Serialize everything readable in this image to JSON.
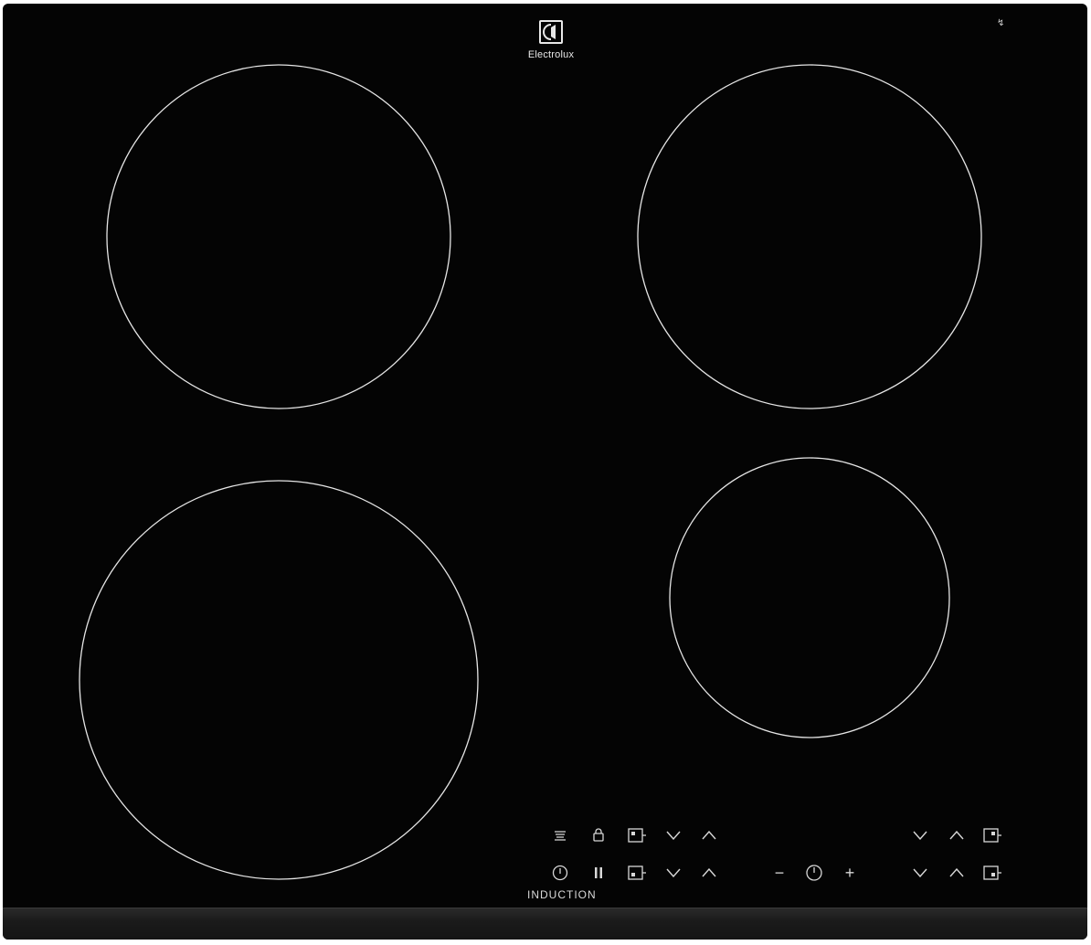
{
  "brand": {
    "name": "Electrolux"
  },
  "corner_mark": "↯",
  "label": {
    "induction": "INDUCTION"
  },
  "zones": [
    "rear-left",
    "rear-right",
    "front-left",
    "front-right"
  ],
  "controls": {
    "row_top": [
      "key-lock",
      "lock",
      "zone-select",
      "down",
      "up",
      "down",
      "up",
      "zone-select"
    ],
    "row_bottom": [
      "power",
      "pause",
      "zone-select",
      "down",
      "up",
      "minus",
      "timer",
      "plus",
      "down",
      "up",
      "zone-select"
    ],
    "minus_symbol": "−",
    "plus_symbol": "+"
  },
  "colors": {
    "glass": "#040404",
    "print": "#d8d8d8",
    "bevel": "#1b1b1b"
  }
}
